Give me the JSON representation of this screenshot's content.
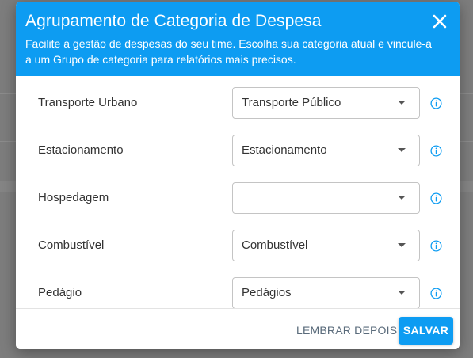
{
  "modal": {
    "title": "Agrupamento de Categoria de Despesa",
    "subtitle": "Facilite a gestão de despesas do seu time. Escolha sua categoria atual e vincule-a a um Grupo de categoria para relatórios mais precisos.",
    "close_icon": "close-icon"
  },
  "rows": [
    {
      "label": "Transporte Urbano",
      "selected": "Transporte Público"
    },
    {
      "label": "Estacionamento",
      "selected": "Estacionamento"
    },
    {
      "label": "Hospedagem",
      "selected": ""
    },
    {
      "label": "Combustível",
      "selected": "Combustível"
    },
    {
      "label": "Pedágio",
      "selected": "Pedágios"
    }
  ],
  "footer": {
    "later_label": "LEMBRAR DEPOIS",
    "save_label": "SALVAR"
  },
  "colors": {
    "accent": "#0d9cf2",
    "info_icon": "#0d9cf2",
    "overlay": "#7d7d7d"
  }
}
